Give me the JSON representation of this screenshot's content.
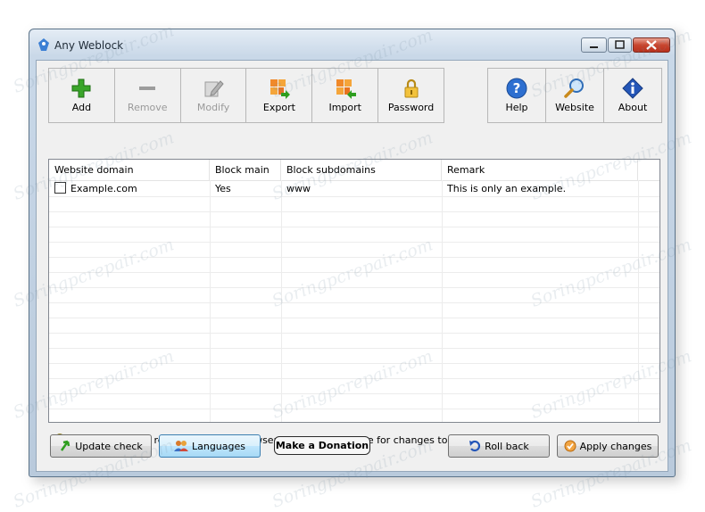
{
  "window": {
    "title": "Any Weblock"
  },
  "toolbar": {
    "left": [
      {
        "label": "Add",
        "icon": "plus-icon",
        "enabled": true
      },
      {
        "label": "Remove",
        "icon": "minus-icon",
        "enabled": false
      },
      {
        "label": "Modify",
        "icon": "pencil-icon",
        "enabled": false
      },
      {
        "label": "Export",
        "icon": "export-icon",
        "enabled": true
      },
      {
        "label": "Import",
        "icon": "import-icon",
        "enabled": true
      },
      {
        "label": "Password",
        "icon": "lock-icon",
        "enabled": true
      }
    ],
    "right": [
      {
        "label": "Help",
        "icon": "help-icon"
      },
      {
        "label": "Website",
        "icon": "magnifier-icon"
      },
      {
        "label": "About",
        "icon": "info-icon"
      }
    ]
  },
  "table": {
    "columns": [
      "Website domain",
      "Block main",
      "Block subdomains",
      "Remark"
    ],
    "rows": [
      {
        "domain": "Example.com",
        "block_main": "Yes",
        "block_subdomains": "www",
        "remark": "This is only an example.",
        "checked": false
      }
    ]
  },
  "tip": {
    "icon": "lightbulb-icon",
    "text": "You may need to restart your web browser and clear its cache for changes to take effect."
  },
  "buttons": {
    "update_check": "Update check",
    "languages": "Languages",
    "donation": "Make a Donation",
    "roll_back": "Roll back",
    "apply_changes": "Apply changes"
  },
  "watermark": "Soringpcrepair.com",
  "colors": {
    "accent": "#3c7fb1",
    "add_green": "#2e9e1f",
    "close_red": "#c8462f"
  }
}
